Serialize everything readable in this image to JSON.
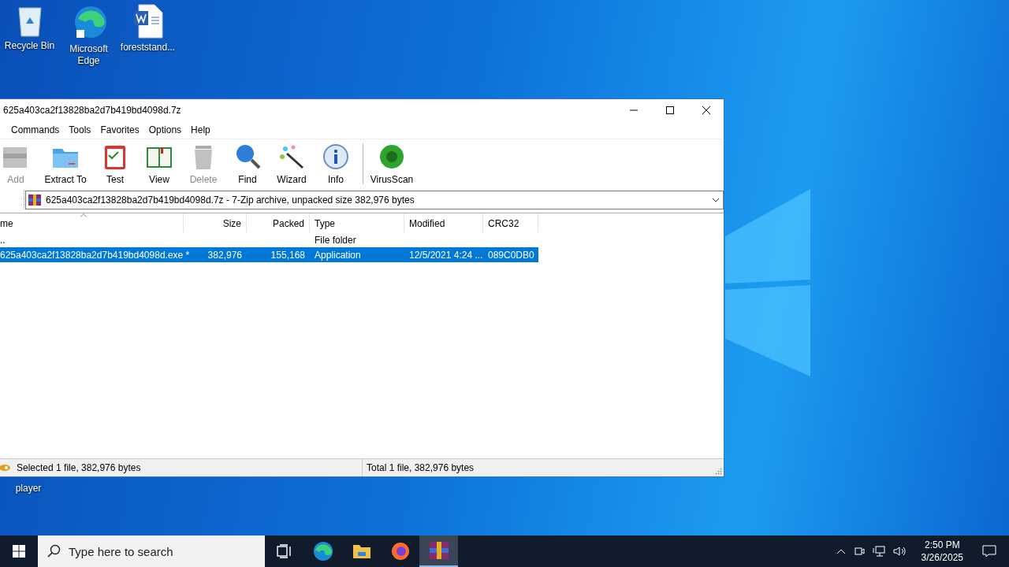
{
  "desktop_icons": [
    {
      "label": "Recycle Bin",
      "kind": "recycle"
    },
    {
      "label": "Microsoft Edge",
      "kind": "edge"
    },
    {
      "label": "foreststand...",
      "kind": "word"
    }
  ],
  "covered_icon_labels": [
    "player"
  ],
  "window": {
    "title": "625a403ca2f13828ba2d7b419bd4098d.7z",
    "menu": [
      "Commands",
      "Tools",
      "Favorites",
      "Options",
      "Help"
    ],
    "toolbar": [
      {
        "label": "Add",
        "kind": "add",
        "disabled": true
      },
      {
        "label": "Extract To",
        "kind": "extract",
        "disabled": false
      },
      {
        "label": "Test",
        "kind": "test",
        "disabled": false
      },
      {
        "label": "View",
        "kind": "view",
        "disabled": false
      },
      {
        "label": "Delete",
        "kind": "delete",
        "disabled": true
      },
      {
        "label": "Find",
        "kind": "find",
        "disabled": false
      },
      {
        "label": "Wizard",
        "kind": "wizard",
        "disabled": false
      },
      {
        "label": "Info",
        "kind": "info",
        "disabled": false
      },
      {
        "label": "VirusScan",
        "kind": "virus",
        "disabled": false
      }
    ],
    "address": "625a403ca2f13828ba2d7b419bd4098d.7z - 7-Zip archive, unpacked size 382,976 bytes",
    "columns": [
      {
        "label": "me",
        "sorted": true
      },
      {
        "label": "Size",
        "sorted": false
      },
      {
        "label": "Packed",
        "sorted": false
      },
      {
        "label": "Type",
        "sorted": false
      },
      {
        "label": "Modified",
        "sorted": false
      },
      {
        "label": "CRC32",
        "sorted": false
      }
    ],
    "rows": [
      {
        "cells": [
          "..",
          "",
          "",
          "File folder",
          "",
          ""
        ],
        "selected": false
      },
      {
        "cells": [
          "625a403ca2f13828ba2d7b419bd4098d.exe *",
          "382,976",
          "155,168",
          "Application",
          "12/5/2021 4:24 ...",
          "089C0DB0"
        ],
        "selected": true
      }
    ],
    "status_left": "Selected 1 file, 382,976 bytes",
    "status_right": "Total 1 file, 382,976 bytes"
  },
  "taskbar": {
    "search_placeholder": "Type here to search",
    "apps": [
      {
        "kind": "taskview",
        "active": false
      },
      {
        "kind": "edge",
        "active": false
      },
      {
        "kind": "explorer",
        "active": false
      },
      {
        "kind": "firefox",
        "active": false
      },
      {
        "kind": "winrar",
        "active": true
      }
    ],
    "time": "2:50 PM",
    "date": "3/26/2025"
  }
}
